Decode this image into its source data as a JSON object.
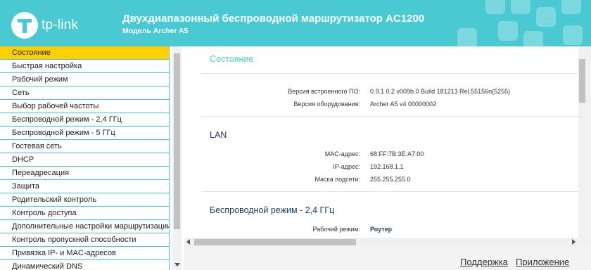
{
  "header": {
    "logo_text": "tp-link",
    "title": "Двухдиапазонный беспроводной маршрутизатор AC1200",
    "subtitle": "Модель Archer A5"
  },
  "colors": {
    "accent": "#4ac9d3",
    "active_menu": "#fdd000",
    "heading_dark": "#1d3c5c"
  },
  "sidebar": {
    "items": [
      {
        "label": "Состояние",
        "active": true
      },
      {
        "label": "Быстрая настройка"
      },
      {
        "label": "Рабочий режим"
      },
      {
        "label": "Сеть"
      },
      {
        "label": "Выбор рабочей частоты"
      },
      {
        "label": "Беспроводной режим - 2,4 ГГц"
      },
      {
        "label": "Беспроводной режим - 5 ГГц"
      },
      {
        "label": "Гостевая сеть"
      },
      {
        "label": "DHCP"
      },
      {
        "label": "Переадресация"
      },
      {
        "label": "Защита"
      },
      {
        "label": "Родительский контроль"
      },
      {
        "label": "Контроль доступа"
      },
      {
        "label": "Дополнительные настройки маршрутизации"
      },
      {
        "label": "Контроль пропускной способности"
      },
      {
        "label": "Привязка IP- и MAC-адресов"
      },
      {
        "label": "Динамический DNS"
      }
    ]
  },
  "main": {
    "status_title": "Состояние",
    "firmware": {
      "label": "Версия встроенного ПО:",
      "value": "0.9.1 0.2 v009b.0 Build 181213 Rel.55156n(5255)"
    },
    "hardware": {
      "label": "Версия оборудования:",
      "value": "Archer A5 v4 00000002"
    },
    "lan_title": "LAN",
    "lan_mac": {
      "label": "MAC-адрес:",
      "value": "68:FF:7B:3E:A7:00"
    },
    "lan_ip": {
      "label": "IP-адрес:",
      "value": "192.168.1.1"
    },
    "lan_mask": {
      "label": "Маска подсети:",
      "value": "255.255.255.0"
    },
    "wireless_title": "Беспроводной режим - 2,4 ГГц",
    "work_mode": {
      "label": "Рабочий режим:",
      "value": "Роутер"
    }
  },
  "footer": {
    "support": "Поддержка",
    "app": "Приложение"
  }
}
